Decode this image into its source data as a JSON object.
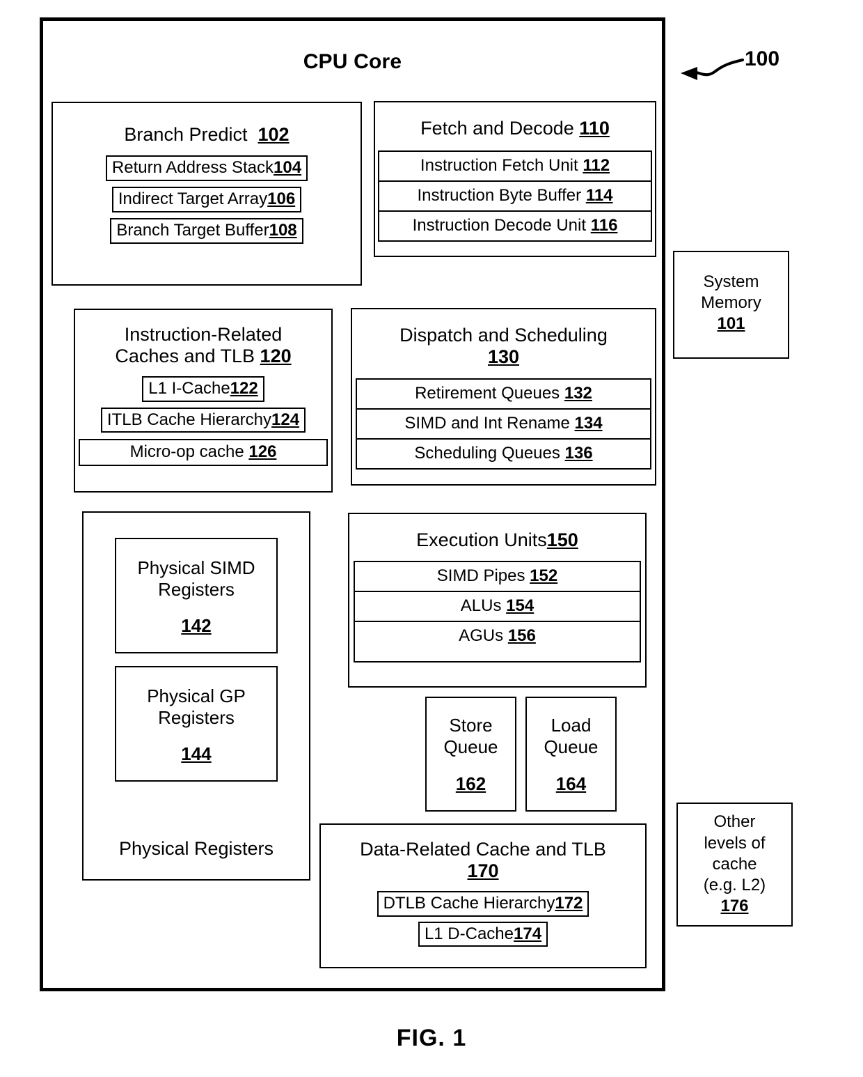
{
  "figure": {
    "caption": "FIG. 1",
    "diagram_reference": "100"
  },
  "cpu_core": {
    "title": "CPU Core",
    "branch_predict": {
      "title": "Branch Predict",
      "ref": "102",
      "items": [
        {
          "label": "Return Address Stack",
          "ref": "104"
        },
        {
          "label": "Indirect Target Array",
          "ref": "106"
        },
        {
          "label": "Branch Target Buffer",
          "ref": "108"
        }
      ]
    },
    "fetch_decode": {
      "title": "Fetch and Decode",
      "ref": "110",
      "items": [
        {
          "label": "Instruction Fetch Unit",
          "ref": "112"
        },
        {
          "label": "Instruction Byte Buffer",
          "ref": "114"
        },
        {
          "label": "Instruction Decode Unit",
          "ref": "116"
        }
      ]
    },
    "instruction_caches": {
      "title_line1": "Instruction-Related",
      "title_line2": "Caches and TLB",
      "ref": "120",
      "items": [
        {
          "label": "L1 I-Cache",
          "ref": "122"
        },
        {
          "label": "ITLB Cache Hierarchy",
          "ref": "124"
        },
        {
          "label": "Micro-op cache",
          "ref": "126"
        }
      ]
    },
    "dispatch_scheduling": {
      "title": "Dispatch and Scheduling",
      "ref": "130",
      "items": [
        {
          "label": "Retirement Queues",
          "ref": "132"
        },
        {
          "label": "SIMD and Int Rename",
          "ref": "134"
        },
        {
          "label": "Scheduling Queues",
          "ref": "136"
        }
      ]
    },
    "physical_registers": {
      "label": "Physical Registers",
      "simd": {
        "line1": "Physical SIMD",
        "line2": "Registers",
        "ref": "142"
      },
      "gp": {
        "line1": "Physical GP",
        "line2": "Registers",
        "ref": "144"
      }
    },
    "execution_units": {
      "title": "Execution Units",
      "ref": "150",
      "items": [
        {
          "label": "SIMD Pipes",
          "ref": "152"
        },
        {
          "label": "ALUs",
          "ref": "154"
        },
        {
          "label": "AGUs",
          "ref": "156"
        }
      ]
    },
    "store_queue": {
      "line1": "Store",
      "line2": "Queue",
      "ref": "162"
    },
    "load_queue": {
      "line1": "Load",
      "line2": "Queue",
      "ref": "164"
    },
    "data_cache": {
      "title": "Data-Related Cache and TLB",
      "ref": "170",
      "items": [
        {
          "label": "DTLB Cache Hierarchy",
          "ref": "172"
        },
        {
          "label": "L1 D-Cache",
          "ref": "174"
        }
      ]
    }
  },
  "external": {
    "system_memory": {
      "line1": "System",
      "line2": "Memory",
      "ref": "101"
    },
    "other_cache": {
      "line1": "Other",
      "line2": "levels of",
      "line3": "cache",
      "line4": "(e.g. L2)",
      "ref": "176"
    }
  },
  "colors": {
    "ink": "#000000",
    "paper": "#ffffff"
  }
}
